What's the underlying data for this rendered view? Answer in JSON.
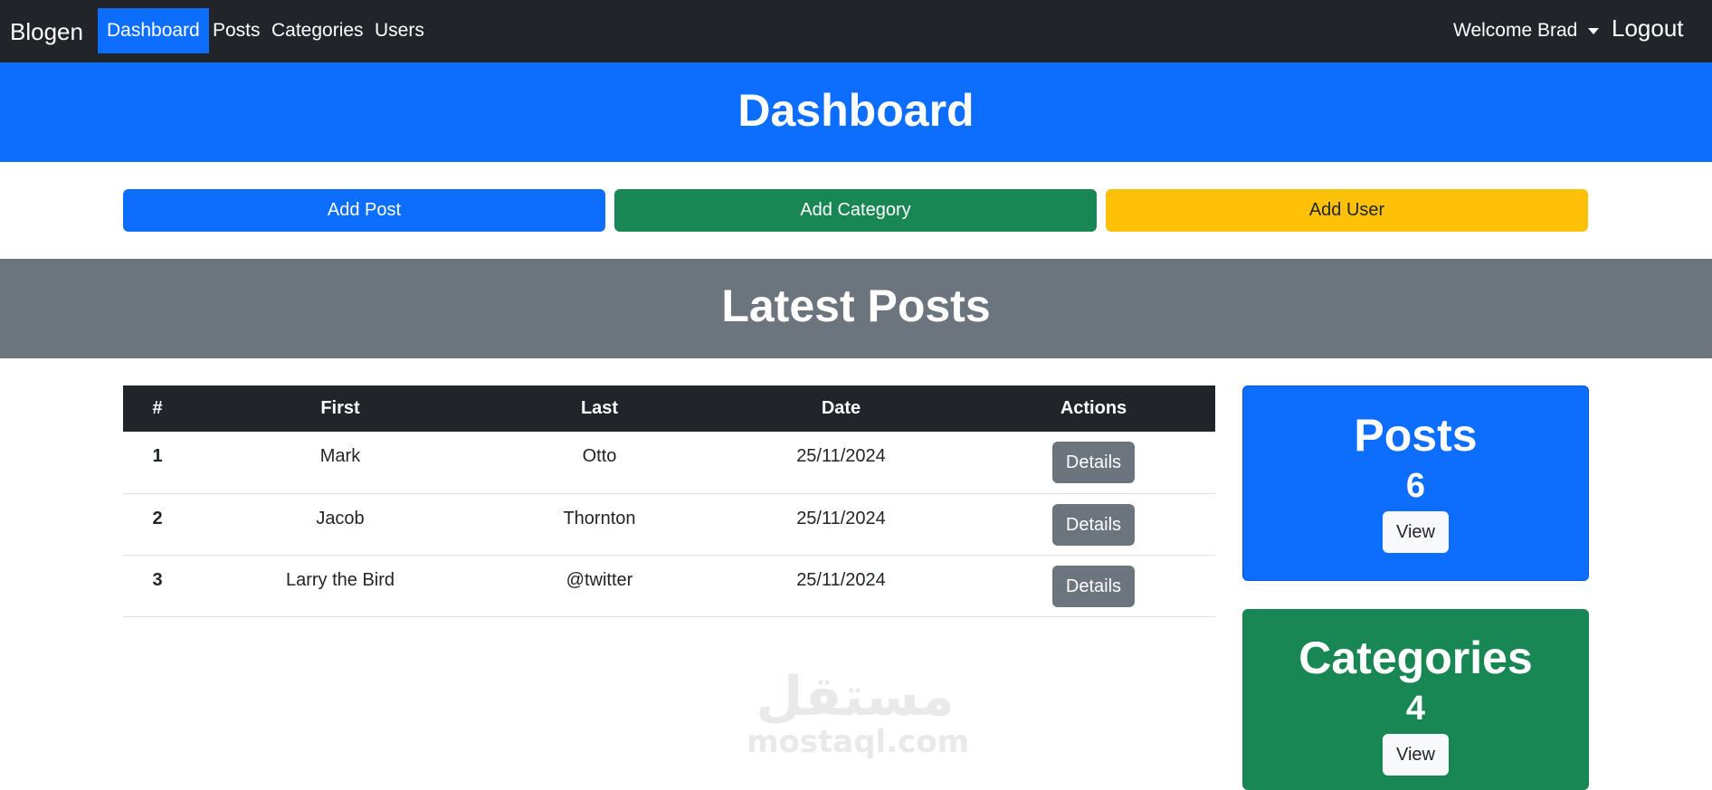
{
  "navbar": {
    "brand": "Blogen",
    "links": [
      {
        "label": "Dashboard",
        "active": true
      },
      {
        "label": "Posts",
        "active": false
      },
      {
        "label": "Categories",
        "active": false
      },
      {
        "label": "Users",
        "active": false
      }
    ],
    "welcome": "Welcome Brad",
    "logout": "Logout"
  },
  "header": {
    "title": "Dashboard"
  },
  "actions": {
    "add_post": "Add Post",
    "add_category": "Add Category",
    "add_user": "Add User"
  },
  "latest_posts": {
    "title": "Latest Posts"
  },
  "table": {
    "columns": [
      "#",
      "First",
      "Last",
      "Date",
      "Actions"
    ],
    "rows": [
      {
        "num": "1",
        "first": "Mark",
        "last": "Otto",
        "date": "25/11/2024",
        "action": "Details"
      },
      {
        "num": "2",
        "first": "Jacob",
        "last": "Thornton",
        "date": "25/11/2024",
        "action": "Details"
      },
      {
        "num": "3",
        "first": "Larry the Bird",
        "last": "@twitter",
        "date": "25/11/2024",
        "action": "Details"
      }
    ]
  },
  "cards": [
    {
      "title": "Posts",
      "count": "6",
      "button": "View"
    },
    {
      "title": "Categories",
      "count": "4",
      "button": "View"
    }
  ],
  "watermark": {
    "arabic": "مستقل",
    "latin": "mostaql.com"
  },
  "colors": {
    "primary": "#0d6efd",
    "success": "#198754",
    "warning": "#ffc107",
    "secondary": "#6c757d",
    "dark": "#212529"
  }
}
